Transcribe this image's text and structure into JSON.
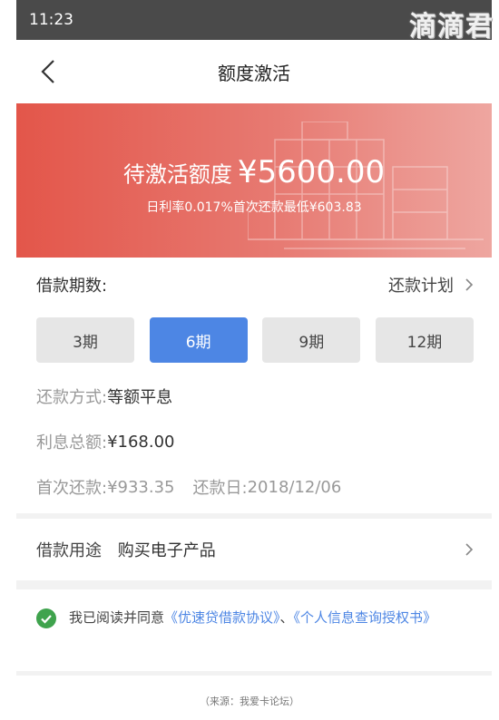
{
  "status_bar": {
    "time": "11:23",
    "watermark": "滴滴君"
  },
  "nav": {
    "title": "额度激活"
  },
  "hero": {
    "label": "待激活额度",
    "amount": "¥5600.00",
    "subtitle": "日利率0.017%首次还款最低¥603.83"
  },
  "period": {
    "label": "借款期数:",
    "plan_link": "还款计划",
    "options": [
      "3期",
      "6期",
      "9期",
      "12期"
    ],
    "selected": "6期"
  },
  "details": {
    "method_label": "还款方式:",
    "method_value": "等额平息",
    "interest_label": "利息总额:",
    "interest_value": "¥168.00",
    "first_label": "首次还款:",
    "first_value": "¥933.35",
    "date_label": "还款日:",
    "date_value": "2018/12/06"
  },
  "purpose": {
    "label": "借款用途",
    "value": "购买电子产品"
  },
  "agreement": {
    "prefix": "我已阅读并同意",
    "link1": "《优速贷借款协议》",
    "separator": "、",
    "link2": "《个人信息查询授权书》",
    "checked": true
  },
  "source": "（来源：我爱卡论坛）",
  "colors": {
    "accent": "#4d86e4",
    "hero_start": "#e3564a",
    "hero_end": "#eea6a0",
    "check": "#3fa34d"
  }
}
